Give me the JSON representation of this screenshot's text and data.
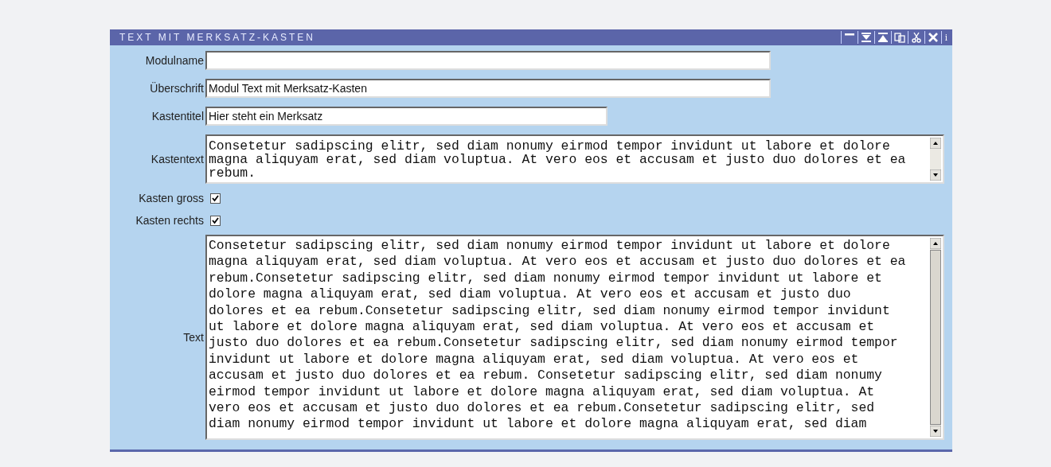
{
  "panel": {
    "title": "TEXT MIT MERKSATZ-KASTEN",
    "tools": [
      {
        "kind": "minimize"
      },
      {
        "kind": "down"
      },
      {
        "kind": "up"
      },
      {
        "kind": "copy"
      },
      {
        "kind": "cut"
      },
      {
        "kind": "close"
      },
      {
        "kind": "info",
        "label": "i"
      }
    ]
  },
  "fields": [
    {
      "kind": "input",
      "label": "Modulname"
    },
    {
      "kind": "input",
      "label": "Überschrift",
      "value": "Modul Text mit Merksatz-Kasten"
    },
    {
      "kind": "shortinput",
      "label": "Kastentitel",
      "value": "Hier steht ein Merksatz"
    },
    {
      "kind": "textarea",
      "label": "Kastentext",
      "lines": [
        "Consetetur sadipscing elitr, sed diam nonumy eirmod tempor invidunt ut labore et dolore",
        "magna aliquyam erat, sed diam voluptua. At vero eos et accusam et justo duo dolores et ea",
        "rebum."
      ]
    },
    {
      "kind": "checkbox",
      "label": "Kasten gross",
      "checked": true
    },
    {
      "kind": "checkbox",
      "label": "Kasten rechts",
      "checked": true
    },
    {
      "kind": "textarea",
      "label": "Text",
      "lines": [
        "Consetetur sadipscing elitr, sed diam nonumy eirmod tempor invidunt ut labore et dolore",
        "magna aliquyam erat, sed diam voluptua. At vero eos et accusam et justo duo dolores et ea",
        "rebum.Consetetur sadipscing elitr, sed diam nonumy eirmod tempor invidunt ut labore et",
        "dolore magna aliquyam erat, sed diam voluptua. At vero eos et accusam et justo duo",
        "dolores et ea rebum.Consetetur sadipscing elitr, sed diam nonumy eirmod tempor invidunt",
        "ut labore et dolore magna aliquyam erat, sed diam voluptua. At vero eos et accusam et",
        "justo duo dolores et ea rebum.Consetetur sadipscing elitr, sed diam nonumy eirmod tempor",
        "invidunt ut labore et dolore magna aliquyam erat, sed diam voluptua. At vero eos et",
        "accusam et justo duo dolores et ea rebum. Consetetur sadipscing elitr, sed diam nonumy",
        "eirmod tempor invidunt ut labore et dolore magna aliquyam erat, sed diam voluptua. At",
        "vero eos et accusam et justo duo dolores et ea rebum.Consetetur sadipscing elitr, sed",
        "diam nonumy eirmod tempor invidunt ut labore et dolore magna aliquyam erat, sed diam"
      ]
    }
  ]
}
